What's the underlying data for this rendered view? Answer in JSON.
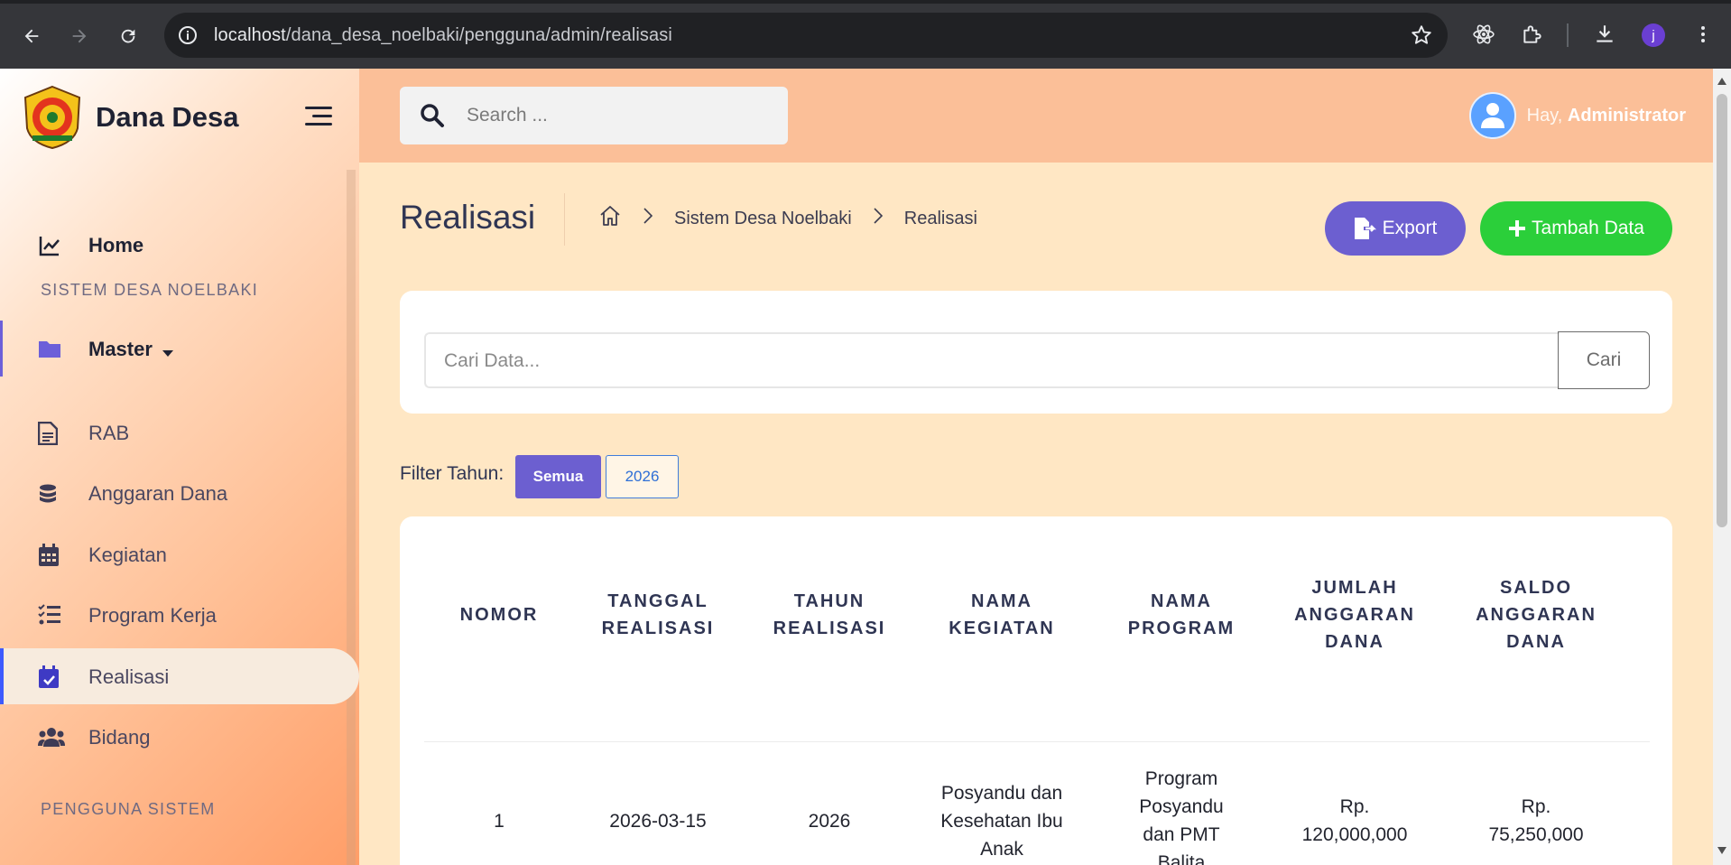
{
  "browser": {
    "url_host": "localhost",
    "url_path": "/dana_desa_noelbaki/pengguna/admin/realisasi",
    "profile_initial": "j"
  },
  "sidebar": {
    "brand": "Dana Desa",
    "home": "Home",
    "section_main": "SISTEM DESA NOELBAKI",
    "items": [
      {
        "label": "Master",
        "icon": "folder-icon"
      },
      {
        "label": "RAB",
        "icon": "document-icon"
      },
      {
        "label": "Anggaran Dana",
        "icon": "coins-icon"
      },
      {
        "label": "Kegiatan",
        "icon": "calendar-icon"
      },
      {
        "label": "Program Kerja",
        "icon": "list-check-icon"
      },
      {
        "label": "Realisasi",
        "icon": "calendar-check-icon"
      },
      {
        "label": "Bidang",
        "icon": "users-icon"
      }
    ],
    "section_users": "PENGGUNA SISTEM"
  },
  "topbar": {
    "search_placeholder": "Search ...",
    "greeting": "Hay,",
    "user_name": "Administrator"
  },
  "page": {
    "title": "Realisasi",
    "breadcrumb": [
      "Sistem Desa Noelbaki",
      "Realisasi"
    ],
    "export_label": "Export",
    "add_label": "Tambah Data",
    "data_search_placeholder": "Cari Data...",
    "data_search_button": "Cari",
    "filter_label": "Filter Tahun:",
    "filter_options": [
      "Semua",
      "2026"
    ],
    "filter_selected": "Semua"
  },
  "table": {
    "headers": [
      [
        "NOMOR"
      ],
      [
        "TANGGAL",
        "REALISASI"
      ],
      [
        "TAHUN",
        "REALISASI"
      ],
      [
        "NAMA",
        "KEGIATAN"
      ],
      [
        "NAMA",
        "PROGRAM"
      ],
      [
        "JUMLAH",
        "ANGGARAN",
        "DANA"
      ],
      [
        "SALDO",
        "ANGGARAN",
        "DANA"
      ]
    ],
    "rows": [
      {
        "nomor": "1",
        "tanggal": "2026-03-15",
        "tahun": "2026",
        "kegiatan": [
          "Posyandu dan",
          "Kesehatan Ibu",
          "Anak"
        ],
        "program": [
          "Program",
          "Posyandu",
          "dan PMT",
          "Balita"
        ],
        "jumlah": [
          "Rp.",
          "120,000,000"
        ],
        "saldo": [
          "Rp.",
          "75,250,000"
        ]
      }
    ]
  },
  "colors": {
    "accent_purple": "#6c5fd0",
    "accent_green": "#2bcf3a",
    "page_bg": "#ffe7c4",
    "topbar_bg": "#fbbf98"
  }
}
